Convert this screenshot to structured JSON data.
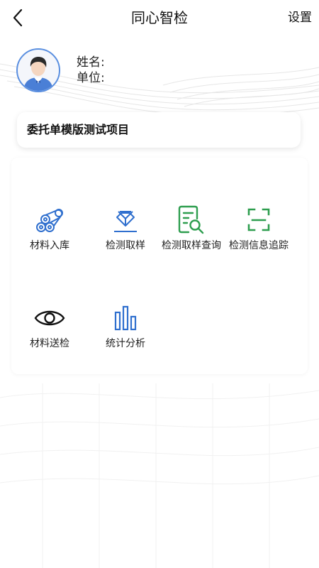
{
  "header": {
    "title": "同心智检",
    "settings_label": "设置"
  },
  "profile": {
    "name_label": "姓名:",
    "unit_label": "单位:"
  },
  "project": {
    "name": "委托单模版测试项目"
  },
  "menu": {
    "items": [
      {
        "label": "材料入库",
        "icon": "material-storage-icon"
      },
      {
        "label": "检测取样",
        "icon": "sampling-icon"
      },
      {
        "label": "检测取样查询",
        "icon": "sampling-query-icon"
      },
      {
        "label": "检测信息追踪",
        "icon": "scan-tracking-icon"
      },
      {
        "label": "材料送检",
        "icon": "eye-icon"
      },
      {
        "label": "统计分析",
        "icon": "bar-chart-icon"
      }
    ]
  },
  "colors": {
    "blue": "#2f6fce",
    "green": "#2e9e4f",
    "black": "#111111"
  }
}
